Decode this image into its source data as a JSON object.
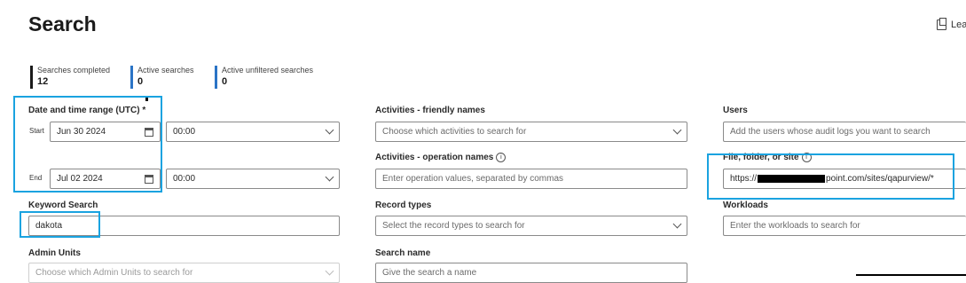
{
  "header": {
    "title": "Search",
    "leave_label": "Lea"
  },
  "stats": [
    {
      "label": "Searches completed",
      "value": "12"
    },
    {
      "label": "Active searches",
      "value": "0"
    },
    {
      "label": "Active unfiltered searches",
      "value": "0"
    }
  ],
  "date_range": {
    "label": "Date and time range (UTC) *",
    "start_label": "Start",
    "start_date": "Jun 30 2024",
    "start_time": "00:00",
    "end_label": "End",
    "end_date": "Jul 02 2024",
    "end_time": "00:00"
  },
  "keyword": {
    "label": "Keyword Search",
    "value": "dakota"
  },
  "admin_units": {
    "label": "Admin Units",
    "placeholder": "Choose which Admin Units to search for"
  },
  "activities_friendly": {
    "label": "Activities - friendly names",
    "placeholder": "Choose which activities to search for"
  },
  "activities_operation": {
    "label": "Activities - operation names",
    "placeholder": "Enter operation values, separated by commas"
  },
  "record_types": {
    "label": "Record types",
    "placeholder": "Select the record types to search for"
  },
  "search_name": {
    "label": "Search name",
    "placeholder": "Give the search a name"
  },
  "users": {
    "label": "Users",
    "placeholder": "Add the users whose audit logs you want to search"
  },
  "file_folder_site": {
    "label": "File, folder, or site",
    "value_prefix": "https://",
    "value_suffix": "point.com/sites/qapurview/*"
  },
  "workloads": {
    "label": "Workloads",
    "placeholder": "Enter the workloads to search for"
  },
  "colors": {
    "highlight": "#1aa3e0",
    "stat_accent": "#2b74c6"
  }
}
